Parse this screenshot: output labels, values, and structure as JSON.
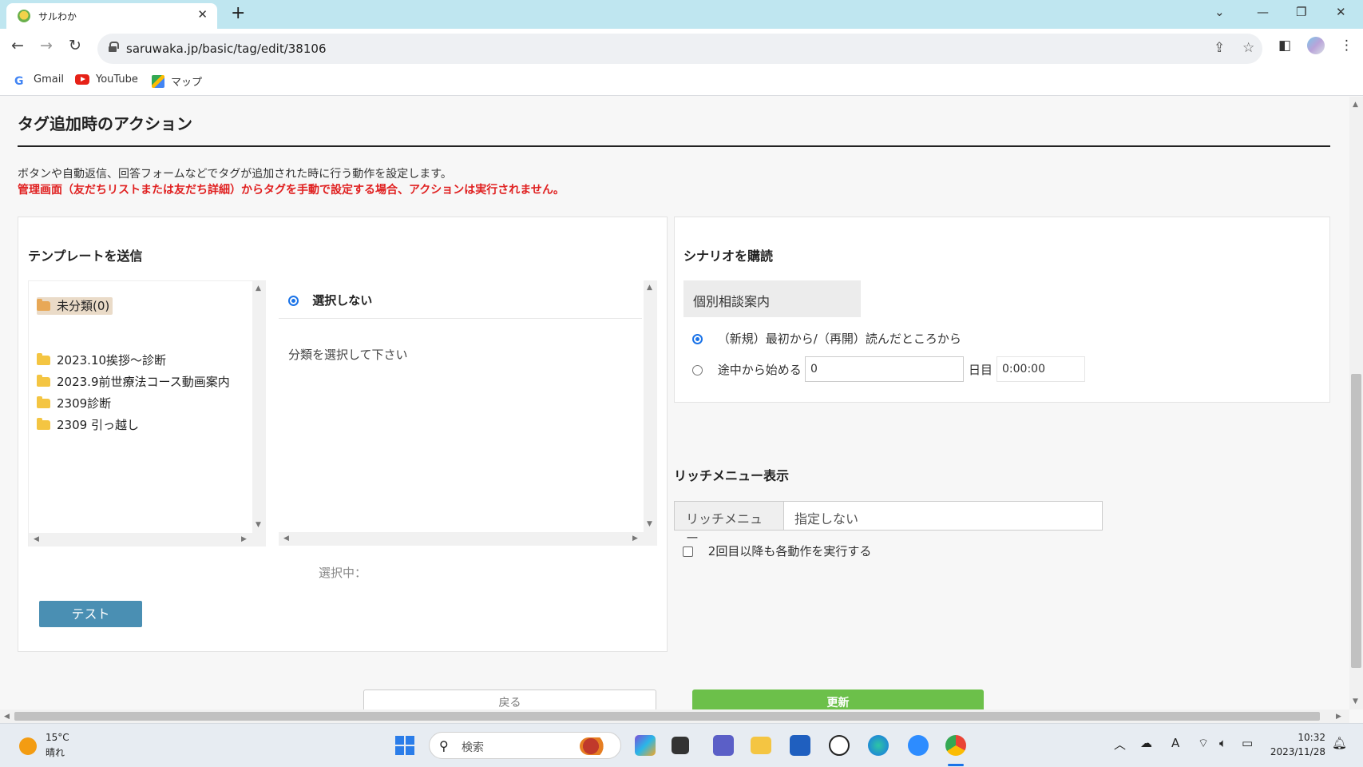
{
  "browser": {
    "tab_title": "サルわか",
    "url": "saruwaka.jp/basic/tag/edit/38106",
    "bookmarks": [
      "Gmail",
      "YouTube",
      "マップ"
    ]
  },
  "section": {
    "title": "タグ追加時のアクション",
    "description": "ボタンや自動返信、回答フォームなどでタグが追加された時に行う動作を設定します。",
    "warning": "管理画面（友だちリストまたは友だち詳細）からタグを手動で設定する場合、アクションは実行されません。"
  },
  "template_panel": {
    "title": "テンプレートを送信",
    "selected_folder": "未分類(0)",
    "folders": [
      "2023.10挨拶～診断",
      "2023.9前世療法コース動画案内",
      "2309診断",
      "2309 引っ越し"
    ],
    "no_select_label": "選択しない",
    "prompt": "分類を選択して下さい",
    "selected_label": "選択中：",
    "test_button": "テスト"
  },
  "scenario_panel": {
    "title": "シナリオを購読",
    "scenario_name": "個別相談案内",
    "option_from_start": "（新規）最初から/（再開）読んだところから",
    "option_from_middle": "途中から始める",
    "day_value": "0",
    "day_suffix": "日目",
    "time_value": "0:00:00"
  },
  "rich_menu": {
    "title": "リッチメニュー表示",
    "label": "リッチメニュー",
    "value": "指定しない",
    "repeat_label": "2回目以降も各動作を実行する"
  },
  "footer": {
    "back_button": "戻る",
    "update_button": "更新"
  },
  "taskbar": {
    "temperature": "15°C",
    "condition": "晴れ",
    "search_placeholder": "検索",
    "time": "10:32",
    "date": "2023/11/28"
  }
}
